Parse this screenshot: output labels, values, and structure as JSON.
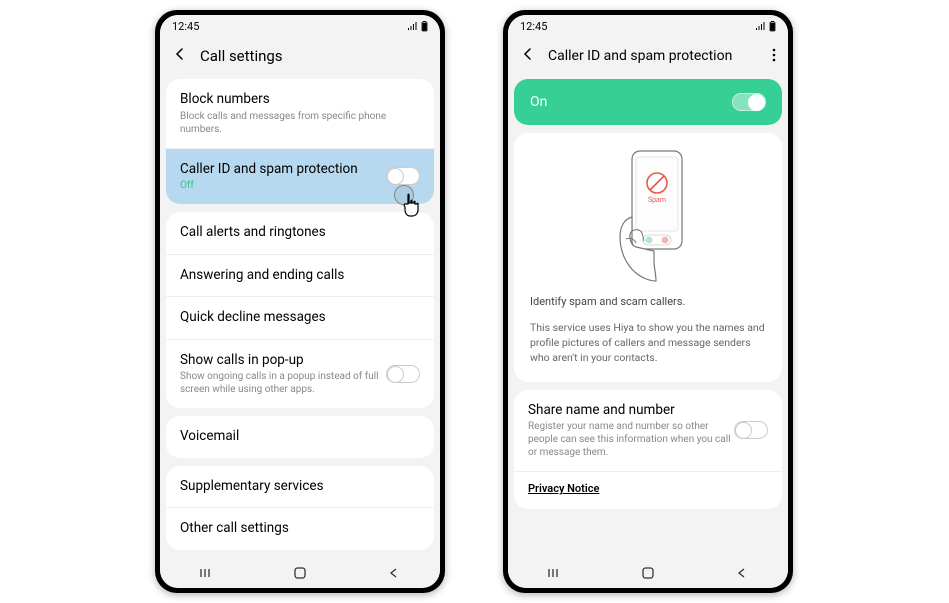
{
  "status": {
    "time": "12:45"
  },
  "phone1": {
    "header": {
      "title": "Call settings"
    },
    "groups": [
      {
        "rows": [
          {
            "title": "Block numbers",
            "sub": "Block calls and messages from specific phone numbers."
          },
          {
            "title": "Caller ID and spam protection",
            "sub": "Off",
            "highlight": true,
            "toggle": false
          }
        ]
      },
      {
        "rows": [
          {
            "title": "Call alerts and ringtones"
          },
          {
            "title": "Answering and ending calls"
          },
          {
            "title": "Quick decline messages"
          },
          {
            "title": "Show calls in pop-up",
            "sub": "Show ongoing calls in a popup instead of full screen while using other apps.",
            "toggle": false
          }
        ]
      },
      {
        "rows": [
          {
            "title": "Voicemail"
          }
        ]
      },
      {
        "rows": [
          {
            "title": "Supplementary services"
          },
          {
            "title": "Other call settings"
          }
        ]
      }
    ]
  },
  "phone2": {
    "header": {
      "title": "Caller ID and spam protection"
    },
    "banner": {
      "label": "On"
    },
    "spam_label": "Spam",
    "description": {
      "line1": "Identify spam and scam callers.",
      "line2": "This service uses Hiya to show you the names and profile pictures of callers and message senders who aren't in your contacts."
    },
    "share": {
      "title": "Share name and number",
      "sub": "Register your name and number so other people can see this information when you call or message them."
    },
    "privacy": "Privacy Notice"
  }
}
